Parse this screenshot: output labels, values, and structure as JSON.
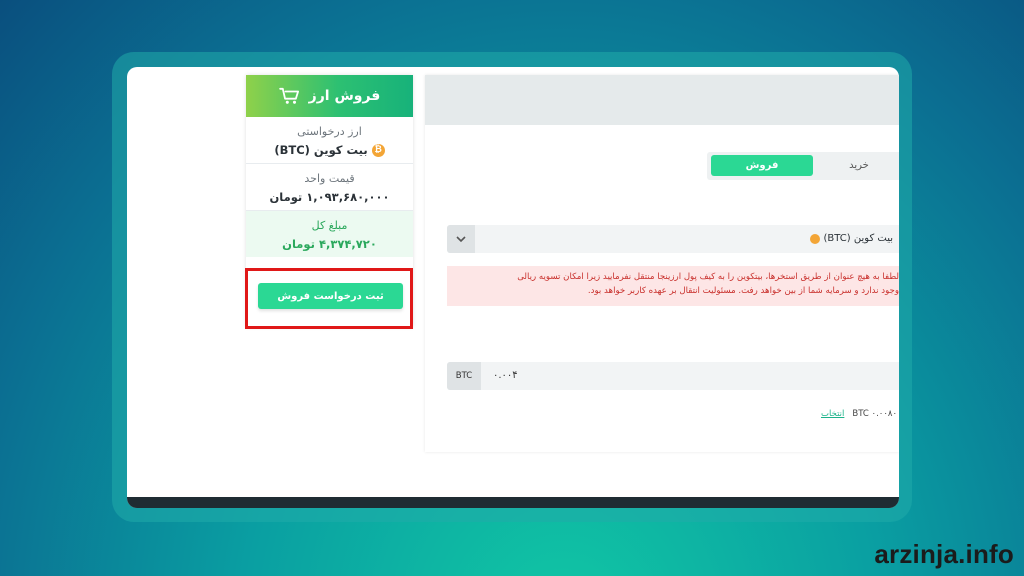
{
  "sidebar": {
    "title": "فروش ارز",
    "requested_currency_label": "ارز درخواستی",
    "requested_currency_value": "بیت کوین (BTC)",
    "unit_price_label": "قیمت واحد",
    "unit_price_value": "۱,۰۹۳,۶۸۰,۰۰۰ تومان",
    "total_label": "مبلغ کل",
    "total_value": "۴,۳۷۴,۷۲۰ تومان",
    "submit_label": "ثبت درخواست فروش"
  },
  "main": {
    "tabs": {
      "sell": "فروش",
      "buy": "خرید"
    },
    "currency_select": "بیت کوین (BTC)",
    "warning_line1": "لطفا به هیچ عنوان از طریق استخرها، بیتکوین را به کیف پول ارزینجا منتقل نفرمایید زیرا امکان تسویه ریالی",
    "warning_line2": "وجود ندارد و سرمایه شما از بین خواهد رفت. مسئولیت انتقال بر عهده کاربر خواهد بود.",
    "amount_unit": "BTC",
    "amount_value": "۰.۰۰۴",
    "balance_text": "BTC ۰.۰۰۸۰",
    "choose_label": "انتخاب"
  },
  "brand": "arzinja.info",
  "colors": {
    "accent": "#2bd894",
    "header_green": "#2dc072",
    "warning_bg": "#fde6e6",
    "highlight": "#e01818"
  }
}
